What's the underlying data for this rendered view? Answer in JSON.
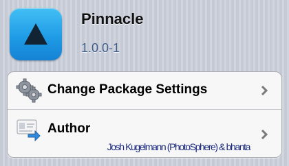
{
  "package": {
    "name": "Pinnacle",
    "version": "1.0.0-1"
  },
  "cells": {
    "settings_label": "Change Package Settings",
    "author_label": "Author",
    "author_value": "Josh Kugelmann (PhotoSphere) & bhanta"
  },
  "icons": {
    "app": "blue-square-up-triangle-icon",
    "settings": "gears-icon",
    "author": "contact-card-arrow-icon",
    "disclosure": "chevron-right-icon"
  },
  "colors": {
    "app_icon_blue": "#1f9ce6",
    "version_text": "#3d5a86",
    "author_detail_text": "#1c2a7e"
  }
}
